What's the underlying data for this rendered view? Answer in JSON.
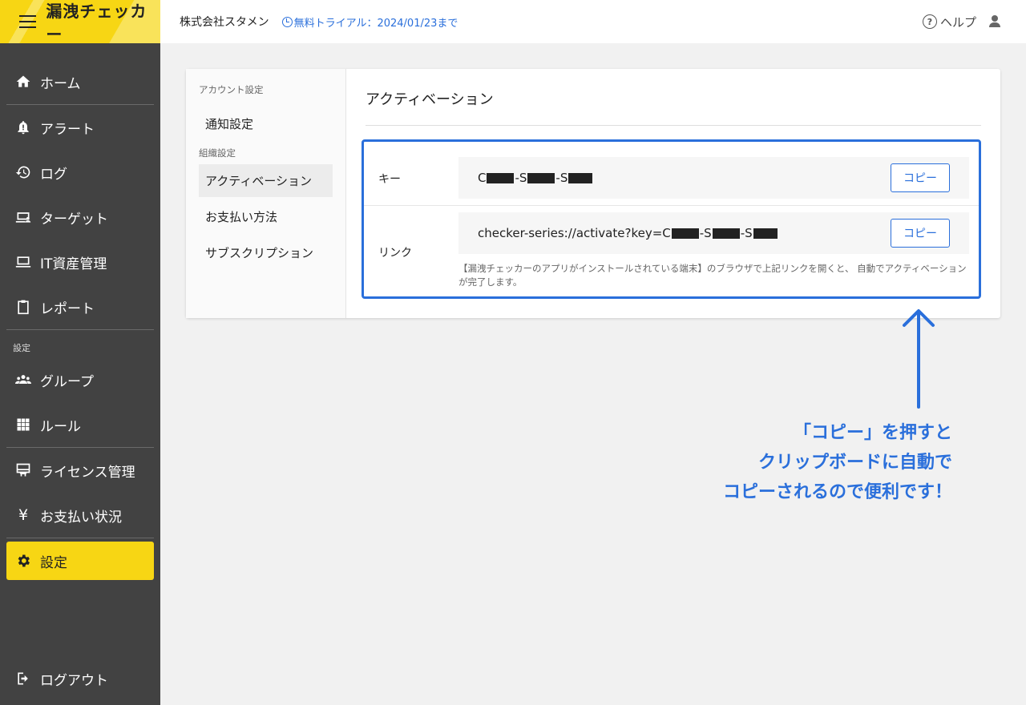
{
  "brand": {
    "title": "漏洩チェッカー"
  },
  "sidebar": {
    "items": [
      {
        "id": "home",
        "label": "ホーム",
        "icon": "home-icon"
      },
      {
        "id": "alert",
        "label": "アラート",
        "icon": "alert-icon"
      },
      {
        "id": "log",
        "label": "ログ",
        "icon": "history-icon"
      },
      {
        "id": "target",
        "label": "ターゲット",
        "icon": "laptop-user-icon"
      },
      {
        "id": "it-assets",
        "label": "IT資産管理",
        "icon": "laptop-icon"
      },
      {
        "id": "report",
        "label": "レポート",
        "icon": "clipboard-icon"
      }
    ],
    "section_settings": "設定",
    "settings_items": [
      {
        "id": "group",
        "label": "グループ",
        "icon": "group-icon"
      },
      {
        "id": "rule",
        "label": "ルール",
        "icon": "grid-icon"
      }
    ],
    "admin_items": [
      {
        "id": "license",
        "label": "ライセンス管理",
        "icon": "license-icon"
      },
      {
        "id": "payment-status",
        "label": "お支払い状況",
        "icon": "yen-icon"
      }
    ],
    "active_item": {
      "id": "settings",
      "label": "設定",
      "icon": "gear-icon"
    },
    "logout": {
      "label": "ログアウト",
      "icon": "logout-icon"
    }
  },
  "header": {
    "company": "株式会社スタメン",
    "trial": "無料トライアル：2024/01/23まで",
    "help": "ヘルプ"
  },
  "subnav": {
    "section_account": "アカウント設定",
    "notification": "通知設定",
    "section_org": "組織設定",
    "activation": "アクティベーション",
    "payment_method": "お支払い方法",
    "subscription": "サブスクリプション"
  },
  "content": {
    "title": "アクティベーション",
    "key_label": "キー",
    "key_parts": [
      "C",
      "-S",
      "-S"
    ],
    "link_label": "リンク",
    "link_prefix": "checker-series://activate?key=C",
    "link_parts": [
      "-S",
      "-S"
    ],
    "copy_label": "コピー",
    "note": "【漏洩チェッカーのアプリがインストールされている端末】のブラウザで上記リンクを開くと、 自動でアクティベーションが完了します。"
  },
  "annotation": {
    "line1": "「コピー」を押すと",
    "line2": "クリップボードに自動で",
    "line3": "コピーされるので便利です！"
  },
  "colors": {
    "accent": "#f7d614",
    "sidebar": "#424242",
    "link": "#2a6fdb"
  }
}
